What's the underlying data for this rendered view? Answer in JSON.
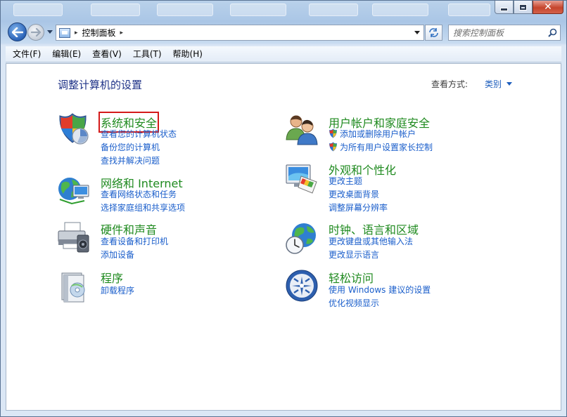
{
  "window": {
    "caption_close": "✕"
  },
  "address": {
    "path_label": "控制面板",
    "separator": "▸",
    "trail_arrow": "▸"
  },
  "search": {
    "placeholder": "搜索控制面板"
  },
  "menu": {
    "items": [
      "文件(F)",
      "编辑(E)",
      "查看(V)",
      "工具(T)",
      "帮助(H)"
    ]
  },
  "header": {
    "title": "调整计算机的设置",
    "view_by_label": "查看方式:",
    "view_by_value": "类别"
  },
  "categories": [
    {
      "title": "系统和安全",
      "links": [
        "查看您的计算机状态",
        "备份您的计算机",
        "查找并解决问题"
      ],
      "icon": "shield-icon"
    },
    {
      "title": "网络和 Internet",
      "links": [
        "查看网络状态和任务",
        "选择家庭组和共享选项"
      ],
      "icon": "globe-network-icon"
    },
    {
      "title": "硬件和声音",
      "links": [
        "查看设备和打印机",
        "添加设备"
      ],
      "icon": "printer-icon"
    },
    {
      "title": "程序",
      "links": [
        "卸载程序"
      ],
      "icon": "programs-icon"
    },
    {
      "title": "用户帐户和家庭安全",
      "links": [
        "添加或删除用户帐户",
        "为所有用户设置家长控制"
      ],
      "icon": "users-icon"
    },
    {
      "title": "外观和个性化",
      "links": [
        "更改主题",
        "更改桌面背景",
        "调整屏幕分辨率"
      ],
      "icon": "monitor-palette-icon"
    },
    {
      "title": "时钟、语言和区域",
      "links": [
        "更改键盘或其他输入法",
        "更改显示语言"
      ],
      "icon": "globe-clock-icon"
    },
    {
      "title": "轻松访问",
      "links": [
        "使用 Windows 建议的设置",
        "优化视频显示"
      ],
      "icon": "ease-of-access-icon"
    }
  ],
  "colors": {
    "category_title": "#1f8a1f",
    "link": "#1a5ecb",
    "page_title": "#1e3287",
    "highlight_box": "#d41a1a"
  }
}
